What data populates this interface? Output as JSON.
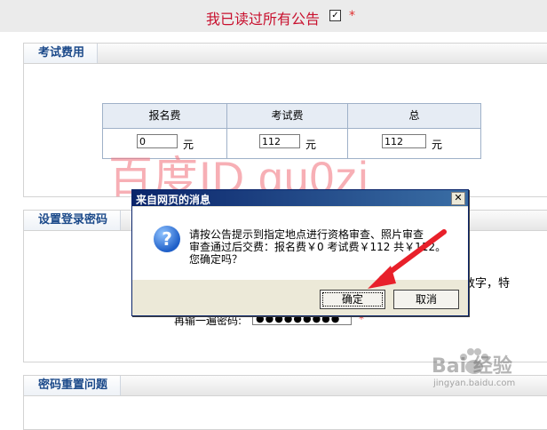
{
  "agreement": {
    "text": "我已读过所有公告",
    "checkbox_mark": "✓",
    "required_mark": "*"
  },
  "fee_section": {
    "title": "考试费用",
    "columns": [
      "报名费",
      "考试费",
      "总"
    ],
    "values": [
      "0",
      "112",
      "112"
    ],
    "unit": "元"
  },
  "login_section": {
    "title": "设置登录密码",
    "partial_hint": "数字，特",
    "repeat_label": "再输一遍密码:",
    "repeat_value": "●●●●●●●●●",
    "required_mark": "*"
  },
  "reset_section": {
    "title": "密码重置问题"
  },
  "watermark": "百度ID gu0zi",
  "dialog": {
    "title": "来自网页的消息",
    "close_glyph": "✕",
    "icon_glyph": "?",
    "message_lines": [
      "请按公告提示到指定地点进行资格审查、照片审查",
      "审查通过后交费：报名费￥0 考试费￥112 共￥112。",
      "您确定吗？"
    ],
    "ok_label": "确定",
    "cancel_label": "取消"
  },
  "logo": {
    "text": "Bai 经验",
    "domain": "jingyan.baidu.com"
  },
  "colors": {
    "accent_red": "#c8102e",
    "arrow_red": "#e8202a",
    "title_blue": "#1c4a8a",
    "dialog_title": "#0a246a"
  }
}
